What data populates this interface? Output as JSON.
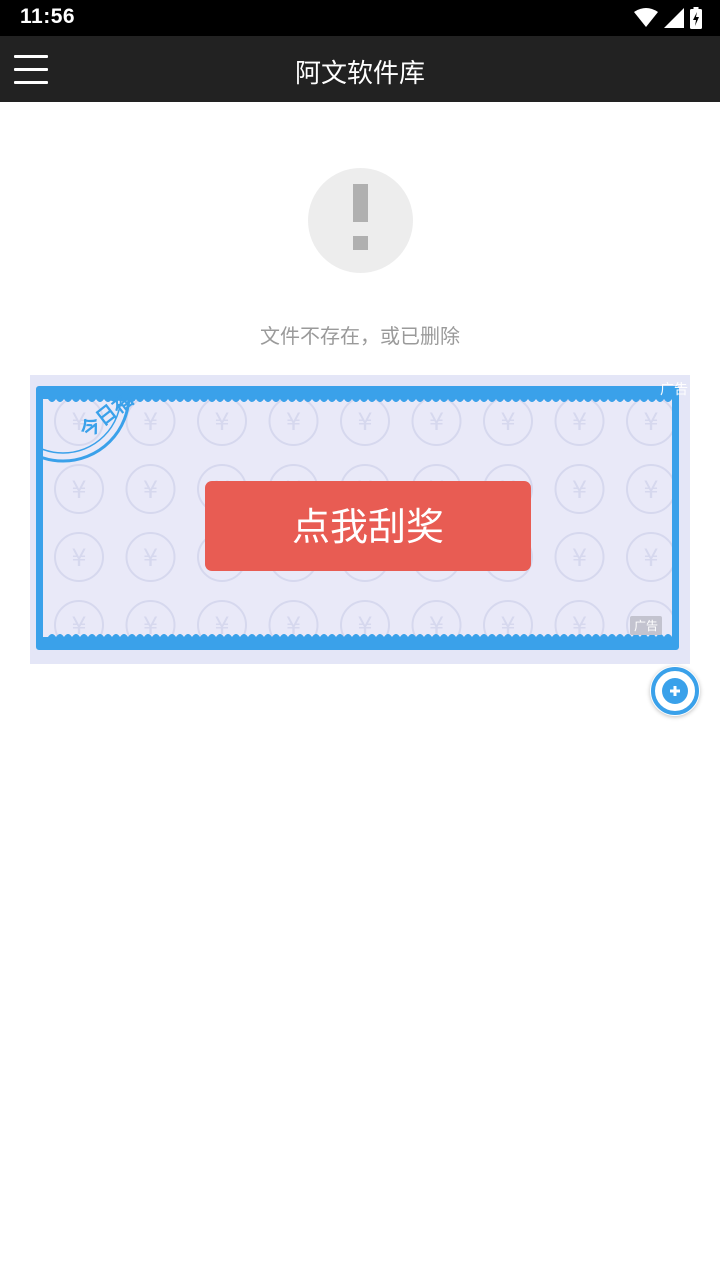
{
  "status_bar": {
    "time": "11:56",
    "icons": [
      "wifi-icon",
      "signal-icon",
      "battery-charging-icon"
    ]
  },
  "app_bar": {
    "title": "阿文软件库",
    "menu_icon": "hamburger-menu-icon"
  },
  "error": {
    "icon": "exclamation-icon",
    "message": "文件不存在，或已删除"
  },
  "ad": {
    "stamp_text": "今日福利",
    "button_label": "点我刮奖",
    "badge_bottom": "广告",
    "badge_top": "广告",
    "pattern_symbol": "¥",
    "colors": {
      "border": "#3aa1ea",
      "button": "#e85c53",
      "background": "#e9e9f8"
    }
  },
  "floating_button": {
    "icon": "plus-icon",
    "accent": "#3aa1ea"
  }
}
